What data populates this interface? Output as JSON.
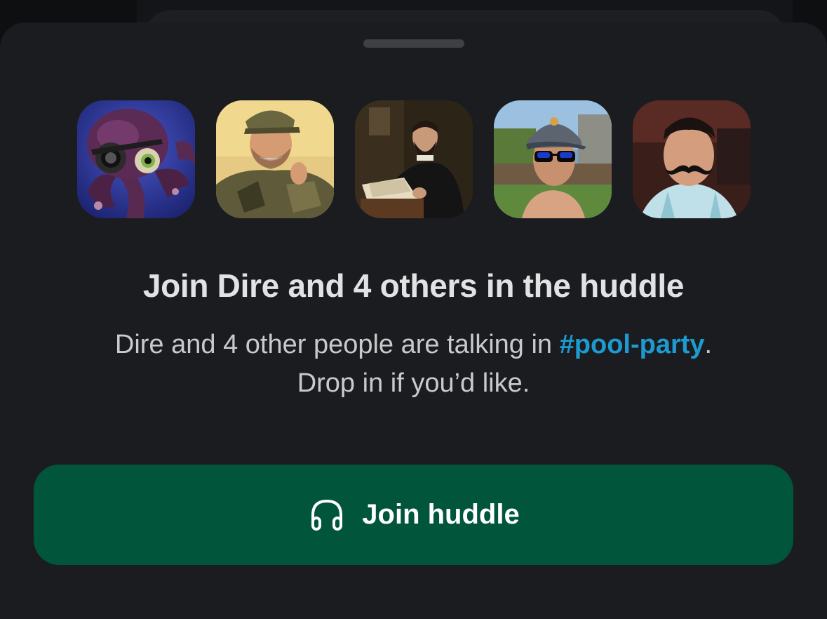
{
  "huddle_sheet": {
    "title": "Join Dire and 4 others in the huddle",
    "subtitle_before_channel": "Dire and 4 other people are talking in ",
    "channel_name": "#pool-party",
    "subtitle_after_channel": ".",
    "subtitle_line2": "Drop in if you’d like.",
    "join_button_label": "Join huddle",
    "join_button_icon": "headphones-icon",
    "participants": [
      {
        "avatar": "octopus-avatar"
      },
      {
        "avatar": "man-camo-hat-avatar"
      },
      {
        "avatar": "portrait-painting-avatar"
      },
      {
        "avatar": "man-sunglasses-avatar"
      },
      {
        "avatar": "man-mustache-avatar"
      }
    ]
  },
  "colors": {
    "sheet_background": "#1b1c1f",
    "link": "#1d9bd1",
    "button_background": "#00553a",
    "button_text": "#ffffff"
  }
}
